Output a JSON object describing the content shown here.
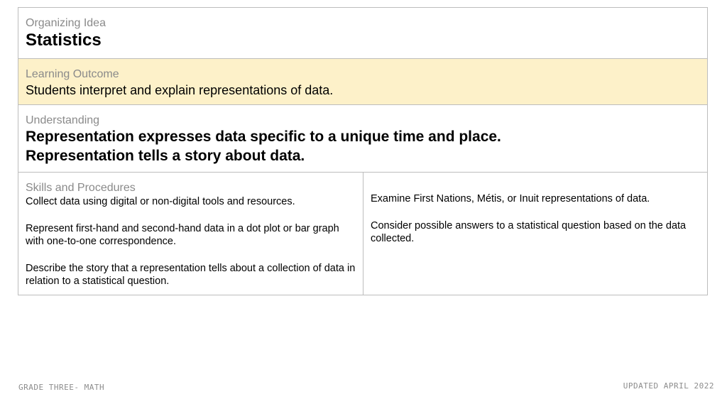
{
  "organizing_idea": {
    "label": "Organizing Idea",
    "title": "Statistics"
  },
  "learning_outcome": {
    "label": "Learning Outcome",
    "text": "Students interpret and explain representations of data."
  },
  "understanding": {
    "label": "Understanding",
    "lines": [
      "Representation expresses data specific to a unique time and place.",
      "Representation tells a story about data."
    ]
  },
  "skills_and_procedures": {
    "label": "Skills and Procedures",
    "left_items": [
      "Collect data using digital or non-digital tools and resources.",
      "Represent first-hand and second-hand data in a dot plot or bar graph with one-to-one correspondence.",
      "Describe the story that a representation tells about a collection of data in relation to a statistical question."
    ],
    "right_items": [
      "Examine First Nations, Métis, or Inuit representations of data.",
      "Consider possible answers to a statistical question based on the data collected."
    ]
  },
  "footer": {
    "left": "GRADE THREE- MATH",
    "right": "UPDATED APRIL 2022"
  },
  "colors": {
    "outcome_background": "#fdf1c9",
    "border": "#bdbdbd",
    "label_text": "#8a8a8a"
  }
}
